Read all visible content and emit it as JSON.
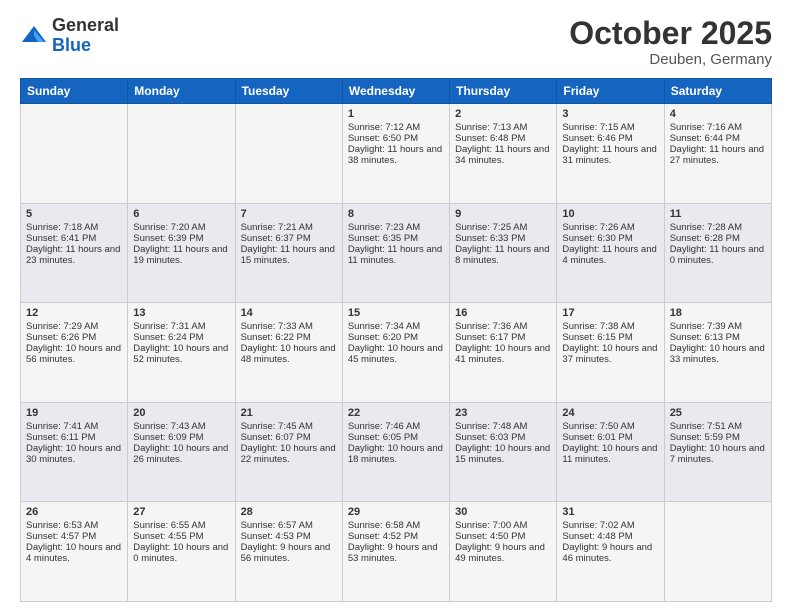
{
  "header": {
    "logo_general": "General",
    "logo_blue": "Blue",
    "month_title": "October 2025",
    "location": "Deuben, Germany"
  },
  "days_of_week": [
    "Sunday",
    "Monday",
    "Tuesday",
    "Wednesday",
    "Thursday",
    "Friday",
    "Saturday"
  ],
  "weeks": [
    [
      {
        "day": "",
        "sunrise": "",
        "sunset": "",
        "daylight": ""
      },
      {
        "day": "",
        "sunrise": "",
        "sunset": "",
        "daylight": ""
      },
      {
        "day": "",
        "sunrise": "",
        "sunset": "",
        "daylight": ""
      },
      {
        "day": "1",
        "sunrise": "Sunrise: 7:12 AM",
        "sunset": "Sunset: 6:50 PM",
        "daylight": "Daylight: 11 hours and 38 minutes."
      },
      {
        "day": "2",
        "sunrise": "Sunrise: 7:13 AM",
        "sunset": "Sunset: 6:48 PM",
        "daylight": "Daylight: 11 hours and 34 minutes."
      },
      {
        "day": "3",
        "sunrise": "Sunrise: 7:15 AM",
        "sunset": "Sunset: 6:46 PM",
        "daylight": "Daylight: 11 hours and 31 minutes."
      },
      {
        "day": "4",
        "sunrise": "Sunrise: 7:16 AM",
        "sunset": "Sunset: 6:44 PM",
        "daylight": "Daylight: 11 hours and 27 minutes."
      }
    ],
    [
      {
        "day": "5",
        "sunrise": "Sunrise: 7:18 AM",
        "sunset": "Sunset: 6:41 PM",
        "daylight": "Daylight: 11 hours and 23 minutes."
      },
      {
        "day": "6",
        "sunrise": "Sunrise: 7:20 AM",
        "sunset": "Sunset: 6:39 PM",
        "daylight": "Daylight: 11 hours and 19 minutes."
      },
      {
        "day": "7",
        "sunrise": "Sunrise: 7:21 AM",
        "sunset": "Sunset: 6:37 PM",
        "daylight": "Daylight: 11 hours and 15 minutes."
      },
      {
        "day": "8",
        "sunrise": "Sunrise: 7:23 AM",
        "sunset": "Sunset: 6:35 PM",
        "daylight": "Daylight: 11 hours and 11 minutes."
      },
      {
        "day": "9",
        "sunrise": "Sunrise: 7:25 AM",
        "sunset": "Sunset: 6:33 PM",
        "daylight": "Daylight: 11 hours and 8 minutes."
      },
      {
        "day": "10",
        "sunrise": "Sunrise: 7:26 AM",
        "sunset": "Sunset: 6:30 PM",
        "daylight": "Daylight: 11 hours and 4 minutes."
      },
      {
        "day": "11",
        "sunrise": "Sunrise: 7:28 AM",
        "sunset": "Sunset: 6:28 PM",
        "daylight": "Daylight: 11 hours and 0 minutes."
      }
    ],
    [
      {
        "day": "12",
        "sunrise": "Sunrise: 7:29 AM",
        "sunset": "Sunset: 6:26 PM",
        "daylight": "Daylight: 10 hours and 56 minutes."
      },
      {
        "day": "13",
        "sunrise": "Sunrise: 7:31 AM",
        "sunset": "Sunset: 6:24 PM",
        "daylight": "Daylight: 10 hours and 52 minutes."
      },
      {
        "day": "14",
        "sunrise": "Sunrise: 7:33 AM",
        "sunset": "Sunset: 6:22 PM",
        "daylight": "Daylight: 10 hours and 48 minutes."
      },
      {
        "day": "15",
        "sunrise": "Sunrise: 7:34 AM",
        "sunset": "Sunset: 6:20 PM",
        "daylight": "Daylight: 10 hours and 45 minutes."
      },
      {
        "day": "16",
        "sunrise": "Sunrise: 7:36 AM",
        "sunset": "Sunset: 6:17 PM",
        "daylight": "Daylight: 10 hours and 41 minutes."
      },
      {
        "day": "17",
        "sunrise": "Sunrise: 7:38 AM",
        "sunset": "Sunset: 6:15 PM",
        "daylight": "Daylight: 10 hours and 37 minutes."
      },
      {
        "day": "18",
        "sunrise": "Sunrise: 7:39 AM",
        "sunset": "Sunset: 6:13 PM",
        "daylight": "Daylight: 10 hours and 33 minutes."
      }
    ],
    [
      {
        "day": "19",
        "sunrise": "Sunrise: 7:41 AM",
        "sunset": "Sunset: 6:11 PM",
        "daylight": "Daylight: 10 hours and 30 minutes."
      },
      {
        "day": "20",
        "sunrise": "Sunrise: 7:43 AM",
        "sunset": "Sunset: 6:09 PM",
        "daylight": "Daylight: 10 hours and 26 minutes."
      },
      {
        "day": "21",
        "sunrise": "Sunrise: 7:45 AM",
        "sunset": "Sunset: 6:07 PM",
        "daylight": "Daylight: 10 hours and 22 minutes."
      },
      {
        "day": "22",
        "sunrise": "Sunrise: 7:46 AM",
        "sunset": "Sunset: 6:05 PM",
        "daylight": "Daylight: 10 hours and 18 minutes."
      },
      {
        "day": "23",
        "sunrise": "Sunrise: 7:48 AM",
        "sunset": "Sunset: 6:03 PM",
        "daylight": "Daylight: 10 hours and 15 minutes."
      },
      {
        "day": "24",
        "sunrise": "Sunrise: 7:50 AM",
        "sunset": "Sunset: 6:01 PM",
        "daylight": "Daylight: 10 hours and 11 minutes."
      },
      {
        "day": "25",
        "sunrise": "Sunrise: 7:51 AM",
        "sunset": "Sunset: 5:59 PM",
        "daylight": "Daylight: 10 hours and 7 minutes."
      }
    ],
    [
      {
        "day": "26",
        "sunrise": "Sunrise: 6:53 AM",
        "sunset": "Sunset: 4:57 PM",
        "daylight": "Daylight: 10 hours and 4 minutes."
      },
      {
        "day": "27",
        "sunrise": "Sunrise: 6:55 AM",
        "sunset": "Sunset: 4:55 PM",
        "daylight": "Daylight: 10 hours and 0 minutes."
      },
      {
        "day": "28",
        "sunrise": "Sunrise: 6:57 AM",
        "sunset": "Sunset: 4:53 PM",
        "daylight": "Daylight: 9 hours and 56 minutes."
      },
      {
        "day": "29",
        "sunrise": "Sunrise: 6:58 AM",
        "sunset": "Sunset: 4:52 PM",
        "daylight": "Daylight: 9 hours and 53 minutes."
      },
      {
        "day": "30",
        "sunrise": "Sunrise: 7:00 AM",
        "sunset": "Sunset: 4:50 PM",
        "daylight": "Daylight: 9 hours and 49 minutes."
      },
      {
        "day": "31",
        "sunrise": "Sunrise: 7:02 AM",
        "sunset": "Sunset: 4:48 PM",
        "daylight": "Daylight: 9 hours and 46 minutes."
      },
      {
        "day": "",
        "sunrise": "",
        "sunset": "",
        "daylight": ""
      }
    ]
  ]
}
